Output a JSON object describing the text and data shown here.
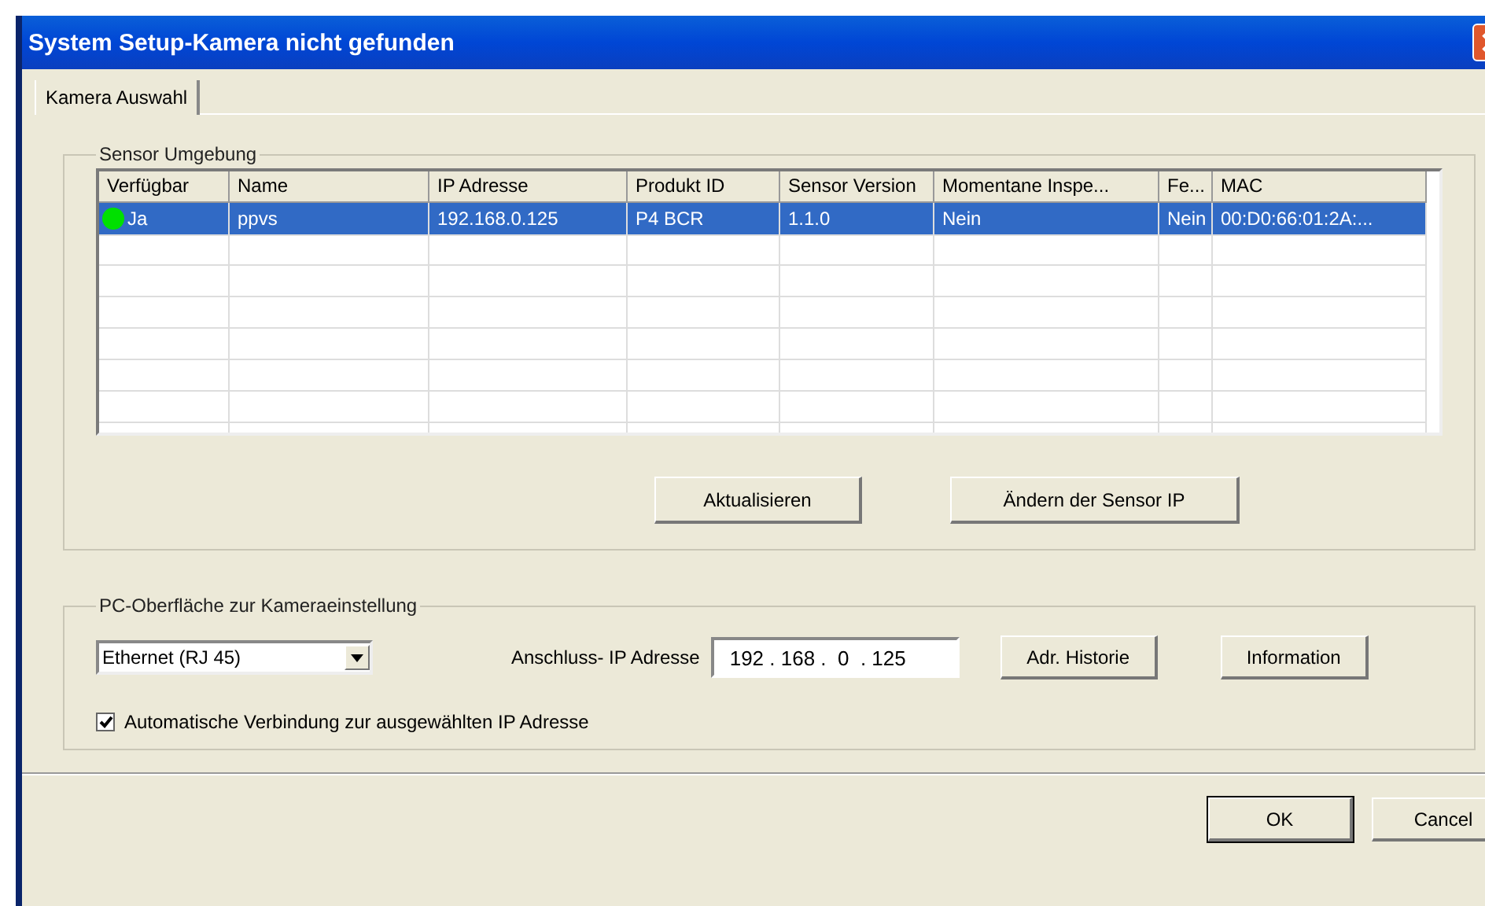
{
  "window": {
    "title": "System Setup-Kamera nicht gefunden"
  },
  "tabs": [
    {
      "label": "Kamera Auswahl",
      "selected": true
    }
  ],
  "sensor_group": {
    "title": "Sensor Umgebung",
    "table": {
      "columns": [
        "Verfügbar",
        "Name",
        "IP Adresse",
        "Produkt ID",
        "Sensor Version",
        "Momentane Inspe...",
        "Fe...",
        "MAC"
      ],
      "rows": [
        {
          "selected": true,
          "color": "#00e000",
          "cells": [
            "Ja",
            "ppvs",
            "192.168.0.125",
            "P4 BCR",
            "1.1.0",
            "Nein",
            "Nein",
            "00:D0:66:01:2A:..."
          ]
        }
      ]
    },
    "buttons": [
      "Aktualisieren",
      "Ändern der Sensor IP"
    ]
  },
  "pc_group": {
    "title": "PC-Oberfläche zur Kameraeinstellung",
    "connection_select": {
      "value": "Ethernet (RJ 45)"
    },
    "ip_label": "Anschluss- IP Adresse",
    "ip_field": {
      "value": "192 . 168 .  0  . 125"
    },
    "buttons": [
      "Adr. Historie",
      "Information"
    ],
    "auto_connect": {
      "label": "Automatische Verbindung zur ausgewählten IP Adresse",
      "checked": true
    }
  },
  "footer_buttons": [
    {
      "label": "OK",
      "default": true
    },
    {
      "label": "Cancel",
      "default": false
    }
  ]
}
